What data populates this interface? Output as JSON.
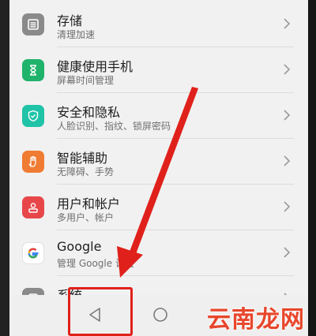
{
  "settings_list": {
    "items": [
      {
        "title": "存储",
        "subtitle": "清理加速",
        "icon": "storage-icon",
        "color": "#8a8a8a"
      },
      {
        "title": "健康使用手机",
        "subtitle": "屏幕时间管理",
        "icon": "hourglass-icon",
        "color": "#1fb36b"
      },
      {
        "title": "安全和隐私",
        "subtitle": "人脸识别、指纹、锁屏密码",
        "icon": "shield-icon",
        "color": "#1fc3a8"
      },
      {
        "title": "智能辅助",
        "subtitle": "无障碍、手势",
        "icon": "hand-icon",
        "color": "#f07b33"
      },
      {
        "title": "用户和帐户",
        "subtitle": "多用户、帐户",
        "icon": "user-icon",
        "color": "#e8474a"
      },
      {
        "title": "Google",
        "subtitle": "管理 Google 设置",
        "icon": "google-icon",
        "color": "#ffffff"
      },
      {
        "title": "系统",
        "subtitle": "",
        "icon": "system-icon",
        "color": "#8a8a8a"
      }
    ]
  },
  "watermark": "云南龙网",
  "colors": {
    "annotation": "#e0211b",
    "watermark": "#e8472c",
    "background": "#f1f1f1"
  }
}
